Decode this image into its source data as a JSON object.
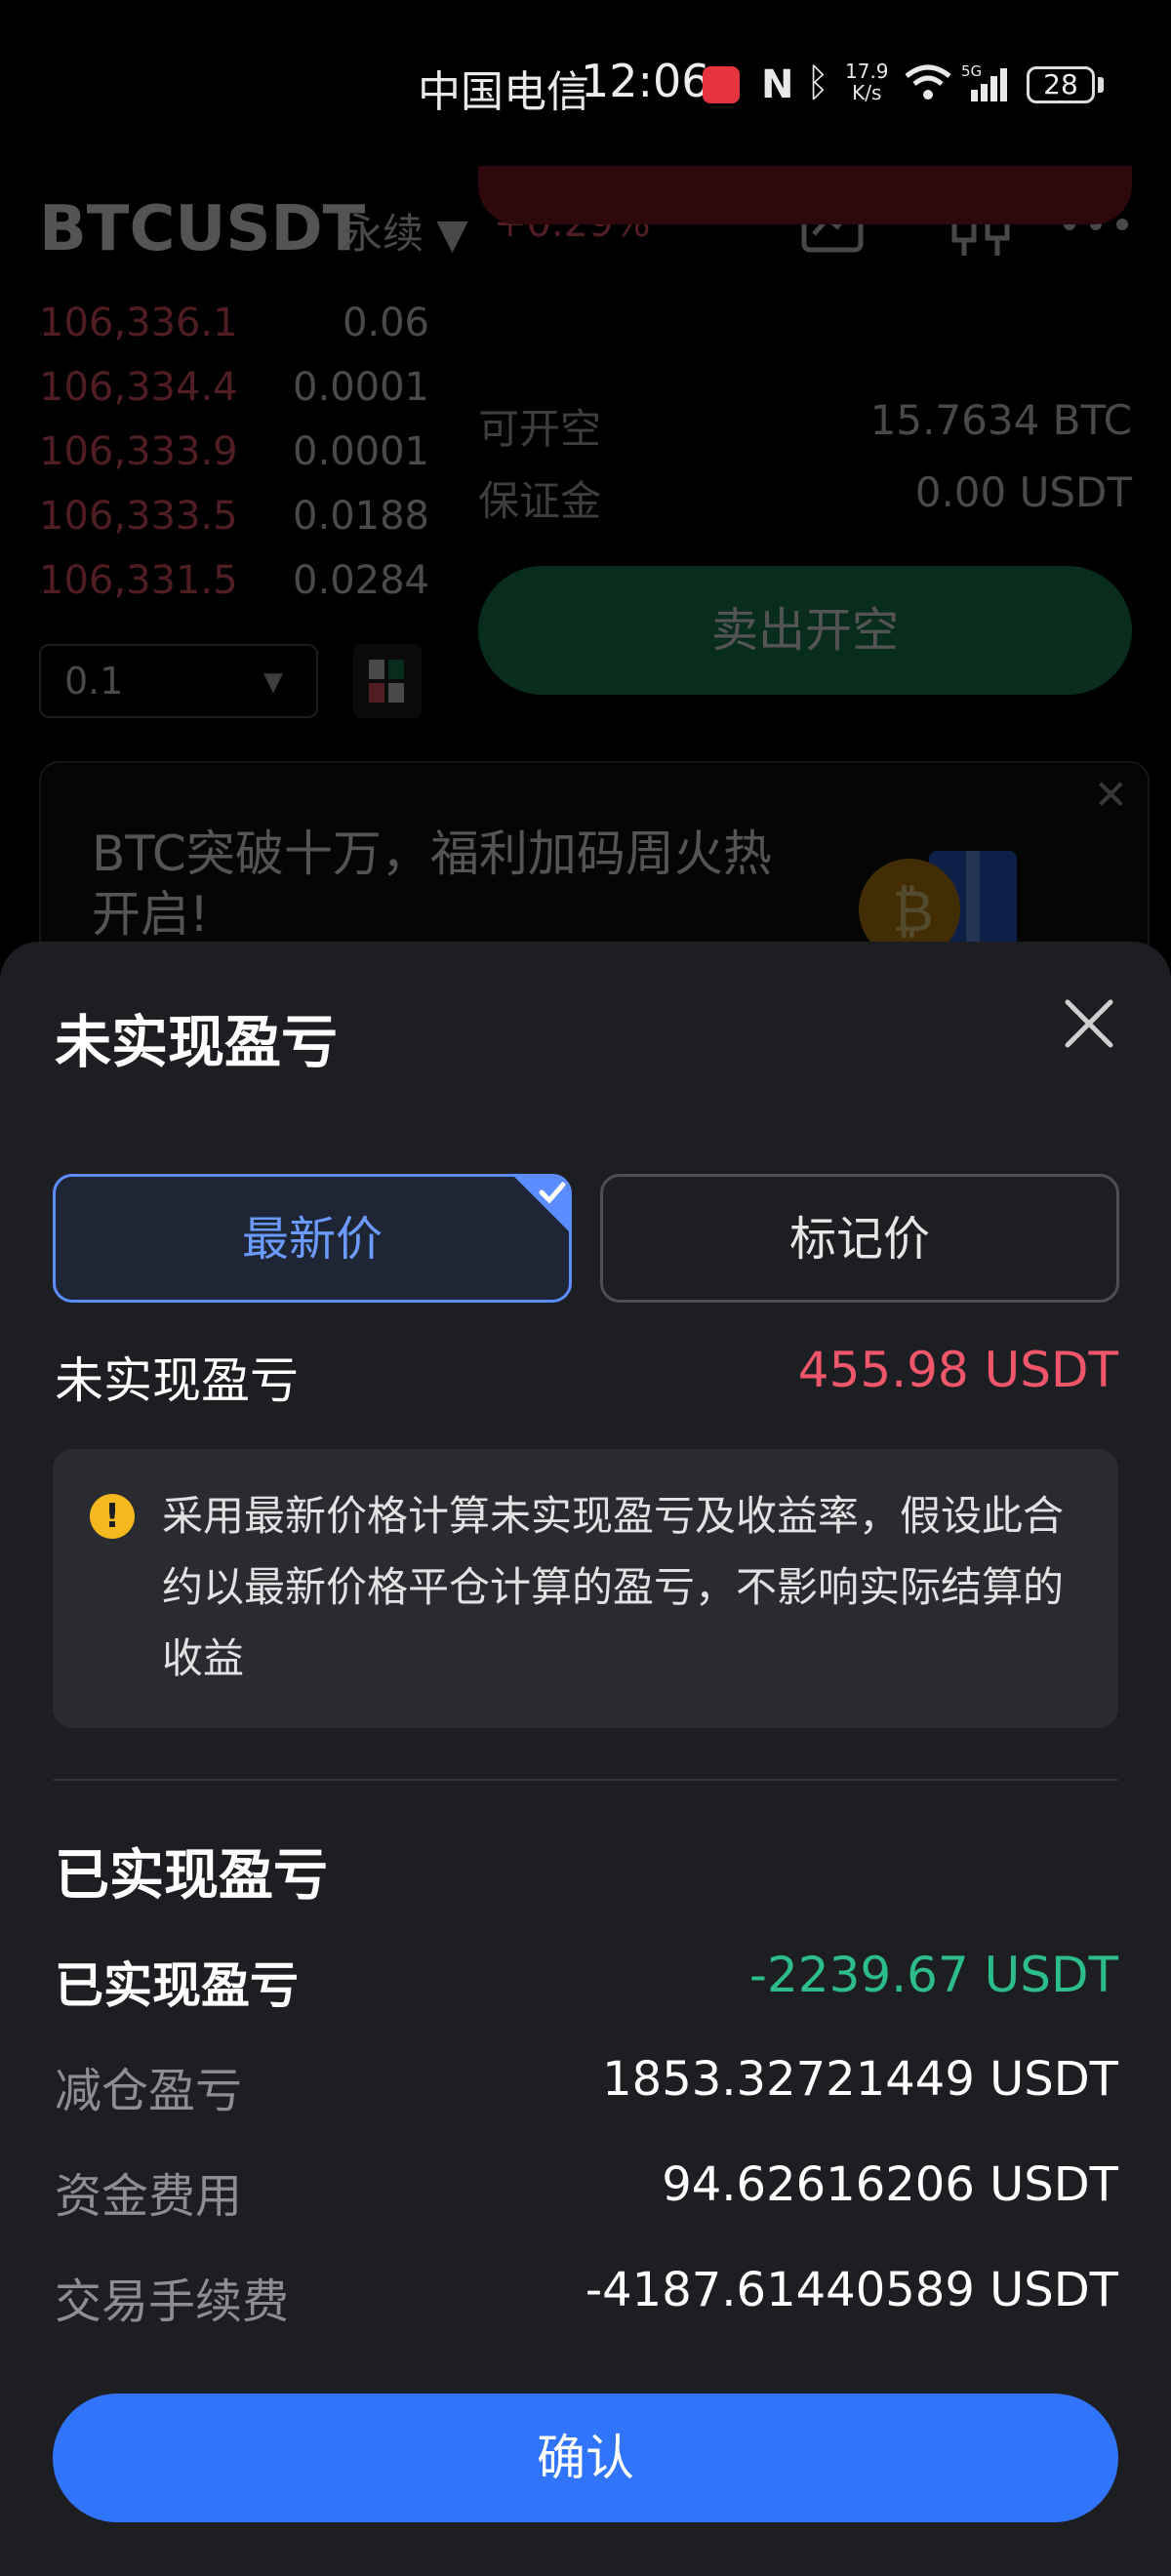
{
  "status_bar": {
    "carrier": "中国电信",
    "time": "12:06",
    "net_speed_top": "17.9",
    "net_speed_bottom": "K/s",
    "network": "5G",
    "battery": "28"
  },
  "background": {
    "pair": "BTCUSDT",
    "contract_type": "永续",
    "change": "+0.29%",
    "orderbook_asks": [
      {
        "price": "106,336.1",
        "qty": "0.06"
      },
      {
        "price": "106,334.4",
        "qty": "0.0001"
      },
      {
        "price": "106,333.9",
        "qty": "0.0001"
      },
      {
        "price": "106,333.5",
        "qty": "0.0188"
      },
      {
        "price": "106,331.5",
        "qty": "0.0284"
      }
    ],
    "step_value": "0.1",
    "can_open_short_label": "可开空",
    "can_open_short_value": "15.7634 BTC",
    "margin_label": "保证金",
    "margin_value": "0.00 USDT",
    "sell_short_button": "卖出开空",
    "banner_text": "BTC突破十万，福利加码周火热开启!"
  },
  "sheet": {
    "title": "未实现盈亏",
    "tabs": [
      {
        "label": "最新价",
        "selected": true
      },
      {
        "label": "标记价",
        "selected": false
      }
    ],
    "unrealized_label": "未实现盈亏",
    "unrealized_value": "455.98 USDT",
    "note": "采用最新价格计算未实现盈亏及收益率，假设此合约以最新价格平仓计算的盈亏，不影响实际结算的收益",
    "realized_section_title": "已实现盈亏",
    "realized_label": "已实现盈亏",
    "realized_value": "-2239.67 USDT",
    "details": [
      {
        "label": "减仓盈亏",
        "value": "1853.32721449 USDT"
      },
      {
        "label": "资金费用",
        "value": "94.62616206 USDT"
      },
      {
        "label": "交易手续费",
        "value": "-4187.61440589 USDT"
      }
    ],
    "confirm_button": "确认"
  },
  "colors": {
    "accent": "#2f74fb",
    "loss": "#f0566a",
    "profit": "#2cbd8a",
    "sheet_bg": "#1d1e22"
  }
}
